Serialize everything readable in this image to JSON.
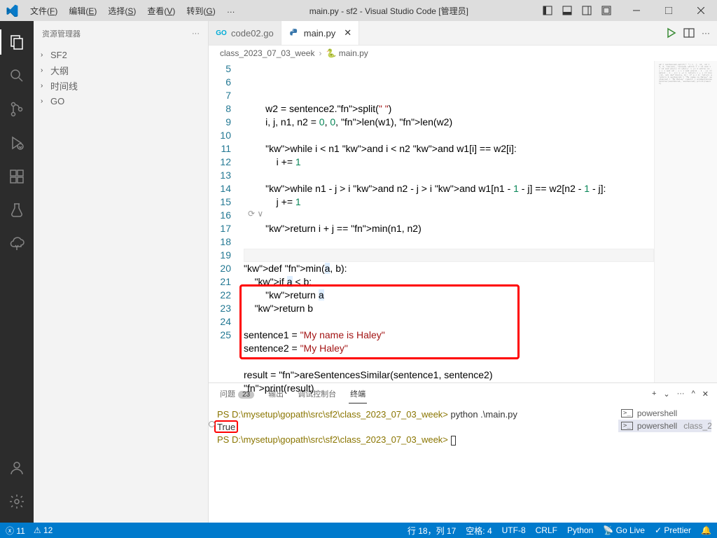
{
  "titlebar": {
    "menus": [
      "文件(F)",
      "编辑(E)",
      "选择(S)",
      "查看(V)",
      "转到(G)",
      "…"
    ],
    "menuUnderlineIdx": [
      3,
      3,
      3,
      3,
      3,
      null
    ],
    "title": "main.py - sf2 - Visual Studio Code [管理员]"
  },
  "sidebar": {
    "header": "资源管理器",
    "items": [
      "SF2",
      "大纲",
      "时间线",
      "GO"
    ]
  },
  "tabs": {
    "items": [
      {
        "icon": "go",
        "label": "code02.go",
        "active": false,
        "close": false
      },
      {
        "icon": "py",
        "label": "main.py",
        "active": true,
        "close": true
      }
    ]
  },
  "breadcrumb": {
    "parts": [
      "class_2023_07_03_week",
      "main.py"
    ]
  },
  "code": {
    "gutterNew": [
      "5",
      "6",
      "7",
      "8",
      "9",
      "10",
      "11",
      "12",
      "13",
      "14",
      "15",
      "",
      "16",
      "17",
      "18",
      "19",
      "20",
      "21",
      "22",
      "23",
      "24",
      "25"
    ],
    "codelens": "⟳ ∨",
    "highlightIdx": 14,
    "lines": [
      "        w2 = sentence2.split(\" \")",
      "        i, j, n1, n2 = 0, 0, len(w1), len(w2)",
      "",
      "        while i < n1 and i < n2 and w1[i] == w2[i]:",
      "            i += 1",
      "",
      "        while n1 - j > i and n2 - j > i and w1[n1 - 1 - j] == w2[n2 - 1 - j]:",
      "            j += 1",
      "",
      "        return i + j == min(n1, n2)",
      "",
      "",
      "def min(a, b):",
      "    if a < b:",
      "        return a",
      "    return b",
      "",
      "sentence1 = \"My name is Haley\"",
      "sentence2 = \"My Haley\"",
      "",
      "result = areSentencesSimilar(sentence1, sentence2)",
      "print(result)"
    ]
  },
  "panel": {
    "tabs": [
      {
        "label": "问题",
        "badge": "23"
      },
      {
        "label": "输出"
      },
      {
        "label": "调试控制台"
      },
      {
        "label": "终端",
        "active": true
      }
    ],
    "terminal": {
      "lines": [
        {
          "prompt": "PS D:\\mysetup\\gopath\\src\\sf2\\class_2023_07_03_week>",
          "cmd": " python .\\main.py"
        },
        {
          "out": "True"
        },
        {
          "prompt": "PS D:\\mysetup\\gopath\\src\\sf2\\class_2023_07_03_week>",
          "cursor": true
        }
      ],
      "side": [
        {
          "icon": "ps",
          "label": "powershell"
        },
        {
          "icon": "ps",
          "label": "powershell",
          "extra": "class_2…",
          "active": true
        }
      ]
    }
  },
  "status": {
    "left": {
      "errors": "11",
      "warnings": "12"
    },
    "right": [
      "行 18，列 17",
      "空格: 4",
      "UTF-8",
      "CRLF",
      "Python",
      "Go Live",
      "Prettier"
    ],
    "icons": {
      "errors": "ⓧ",
      "warnings": "⚠",
      "radio": "📡",
      "check": "✓✓",
      "bell": "🔔"
    }
  },
  "chart_data": null
}
